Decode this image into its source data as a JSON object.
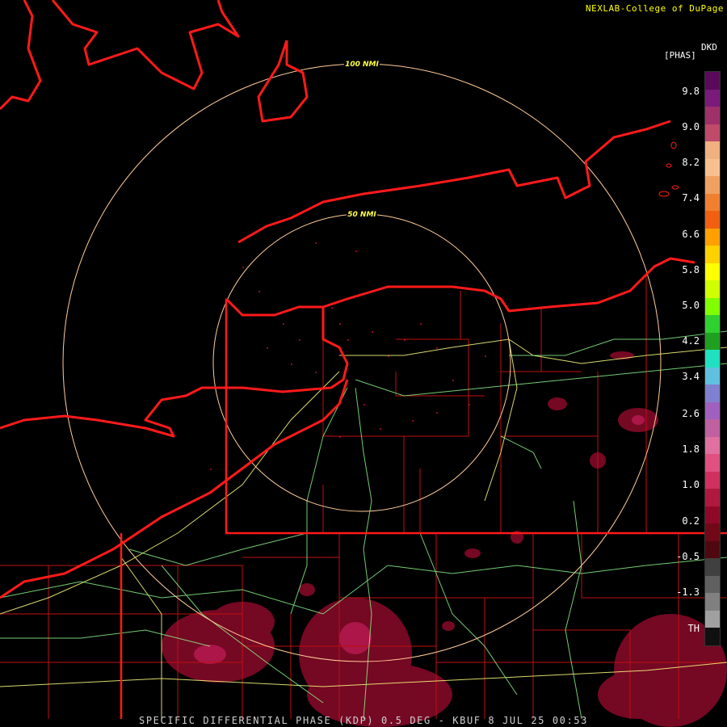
{
  "credit": "NEXLAB-College of DuPage",
  "ring_labels": {
    "outer": "100 NMI",
    "inner": "50 NMI"
  },
  "legend": {
    "product": "DKD",
    "unit": "[PHAS]",
    "ticks": [
      "9.8",
      "9.0",
      "8.2",
      "7.4",
      "6.6",
      "5.8",
      "5.0",
      "4.2",
      "3.4",
      "2.6",
      "1.8",
      "1.0",
      "0.2",
      "-0.5",
      "-1.3",
      "TH"
    ],
    "colors": [
      "#5a0a5a",
      "#7a1a7a",
      "#a0306a",
      "#c04a6a",
      "#f0b080",
      "#f8c090",
      "#f0a060",
      "#f08030",
      "#f06010",
      "#ffa000",
      "#ffd000",
      "#ffff00",
      "#d0ff00",
      "#80ff00",
      "#30d030",
      "#20a020",
      "#20e0c0",
      "#60c0e0",
      "#8080d0",
      "#a060c0",
      "#c060a0",
      "#e070a0",
      "#e05080",
      "#d03060",
      "#b01840",
      "#900828",
      "#700818",
      "#500810",
      "#404040",
      "#606060",
      "#808080",
      "#a0a0a0",
      "#101010"
    ]
  },
  "footer": "SPECIFIC DIFFERENTIAL PHASE (KDP) 0.5 DEG - KBUF 8 JUL 25 00:53",
  "map_colors": {
    "coast": "#ff1a1a",
    "county": "#c01010",
    "road": "#90ff90",
    "highway": "#ffff80",
    "range_ring": "#ffcc99",
    "echo": "#8a0a2a",
    "echo_hot": "#d02060"
  }
}
